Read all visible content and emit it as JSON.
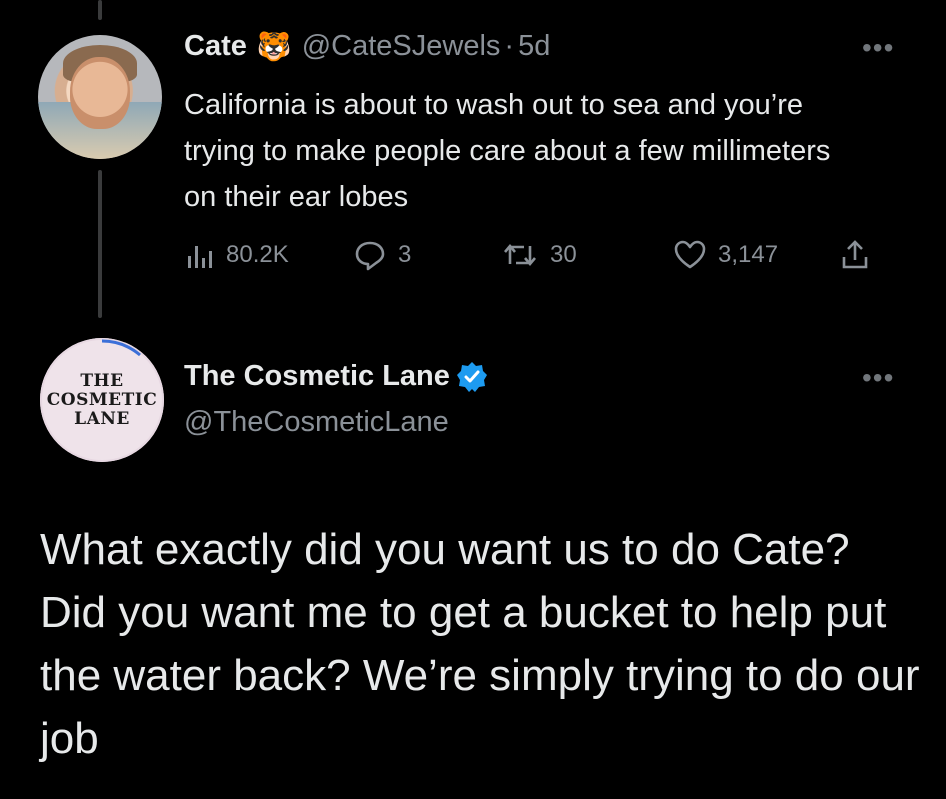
{
  "quoted_tweet": {
    "author_name": "Cate",
    "emoji": "🐯",
    "handle": "@CateSJewels",
    "separator": "·",
    "age": "5d",
    "text": "California is about to wash out to sea and you’re trying to make people care about a few millimeters on their ear lobes",
    "stats": {
      "views": "80.2K",
      "replies": "3",
      "retweets": "30",
      "likes": "3,147"
    }
  },
  "reply_tweet": {
    "author_name": "The Cosmetic Lane",
    "handle": "@TheCosmeticLane",
    "avatar_logo_lines": [
      "THE",
      "COSMETIC",
      "LANE"
    ],
    "text": "What exactly did you want us to do Cate? Did you want me to get a bucket to help put the water back? We’re simply trying to do our job"
  },
  "icons": {
    "more": "more-options-icon",
    "views": "analytics-icon",
    "reply": "reply-icon",
    "retweet": "retweet-icon",
    "like": "heart-icon",
    "share": "share-icon",
    "verified": "verified-badge-icon"
  },
  "ui": {
    "more_glyph": "•••"
  },
  "colors": {
    "background": "#000000",
    "text": "#e7e9ea",
    "muted": "#8b9198",
    "verified_blue": "#1d9bf0"
  }
}
